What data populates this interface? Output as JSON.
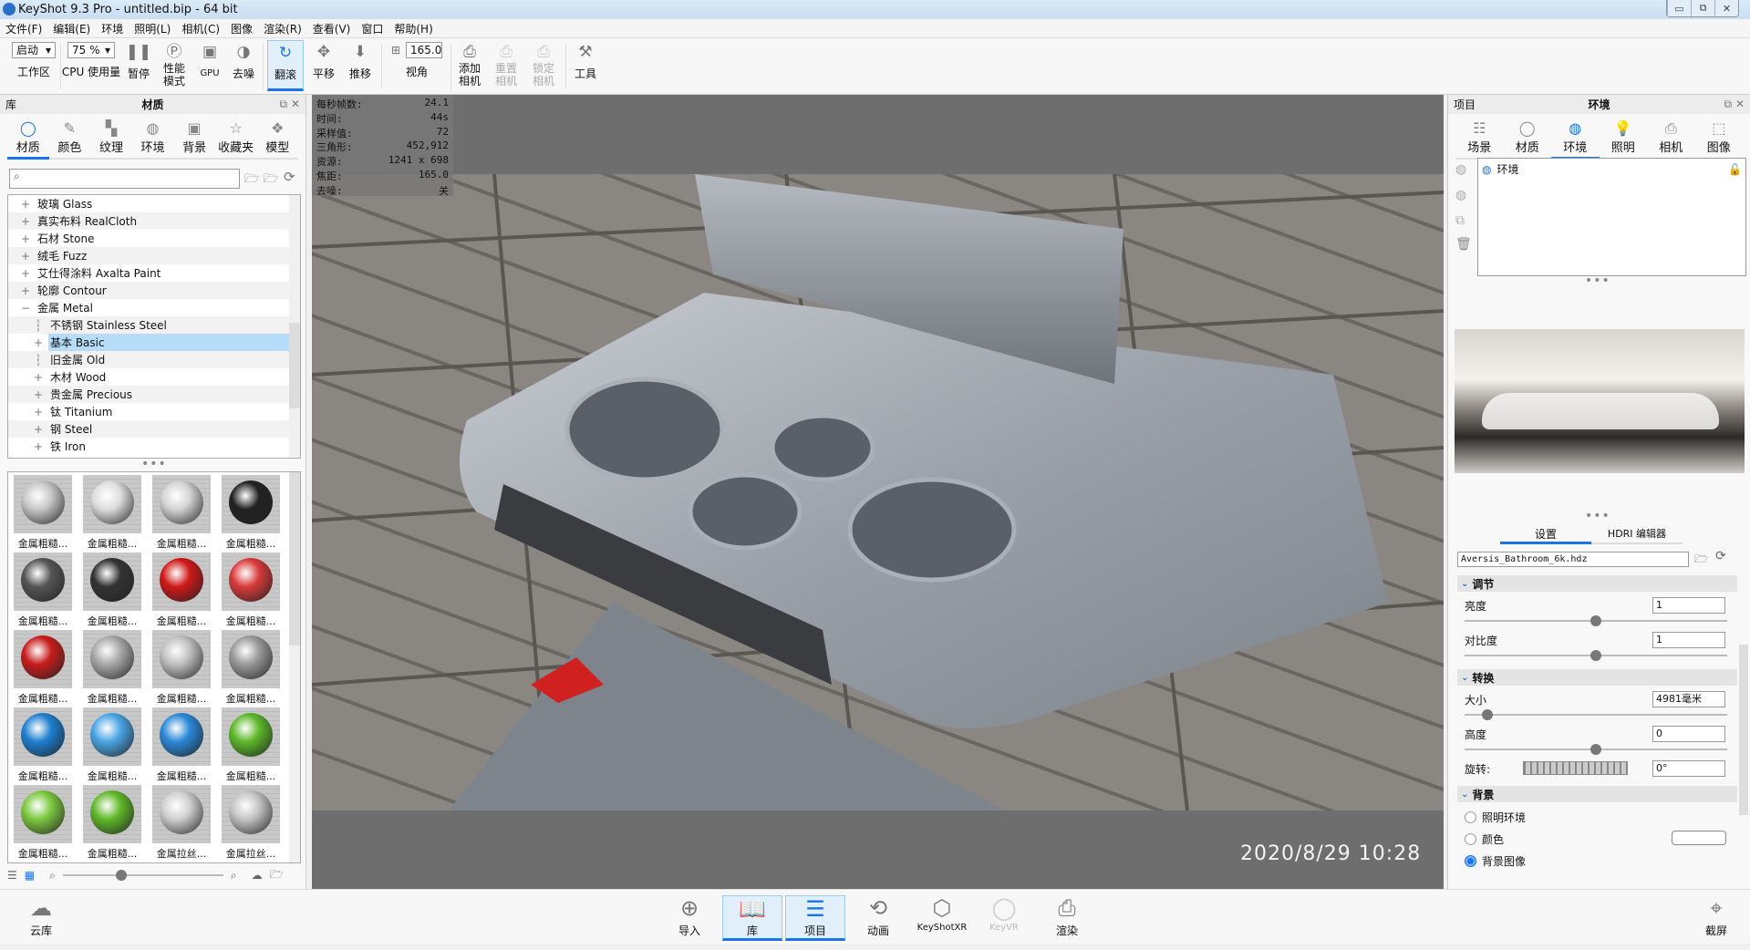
{
  "title": "KeyShot 9.3 Pro  - untitled.bip  - 64 bit",
  "window_buttons": [
    "minimize",
    "restore",
    "close"
  ],
  "menu": [
    "文件(F)",
    "编辑(E)",
    "环境",
    "照明(L)",
    "相机(C)",
    "图像",
    "渲染(R)",
    "查看(V)",
    "窗口",
    "帮助(H)"
  ],
  "toolbar": {
    "workspace_value": "启动",
    "workspace_label": "工作区",
    "cpu_value": "75 %",
    "cpu_label": "CPU 使用量",
    "pause": "暂停",
    "performance": "性能\n模式",
    "gpu": "GPU",
    "denoise": "去噪",
    "tumble": "翻滚",
    "pan": "平移",
    "dolly": "推移",
    "fov_value": "165.0",
    "fov_label": "视角",
    "add_camera": "添加\n相机",
    "reset_camera": "重置\n相机",
    "lock_camera": "锁定\n相机",
    "tools": "工具"
  },
  "library": {
    "header_left": "库",
    "header_title": "材质",
    "tabs": [
      {
        "label": "材质",
        "icon": "material-icon"
      },
      {
        "label": "颜色",
        "icon": "color-icon"
      },
      {
        "label": "纹理",
        "icon": "texture-icon"
      },
      {
        "label": "环境",
        "icon": "globe-icon"
      },
      {
        "label": "背景",
        "icon": "image-icon"
      },
      {
        "label": "收藏夹",
        "icon": "star-icon"
      },
      {
        "label": "模型",
        "icon": "model-icon"
      }
    ],
    "active_tab": "材质",
    "search_placeholder": "",
    "tree": [
      {
        "label": "玻璃 Glass",
        "level": 0,
        "expander": "+"
      },
      {
        "label": "真实布料 RealCloth",
        "level": 0,
        "expander": "+"
      },
      {
        "label": "石材 Stone",
        "level": 0,
        "expander": "+"
      },
      {
        "label": "绒毛 Fuzz",
        "level": 0,
        "expander": "+"
      },
      {
        "label": "艾仕得涂料 Axalta Paint",
        "level": 0,
        "expander": "+"
      },
      {
        "label": "轮廓 Contour",
        "level": 0,
        "expander": "+"
      },
      {
        "label": "金属 Metal",
        "level": 0,
        "expander": "−"
      },
      {
        "label": "不锈钢 Stainless Steel",
        "level": 1,
        "expander": ""
      },
      {
        "label": "基本 Basic",
        "level": 1,
        "expander": "+",
        "selected": true
      },
      {
        "label": "旧金属 Old",
        "level": 1,
        "expander": ""
      },
      {
        "label": "木材 Wood",
        "level": 1,
        "expander": "+"
      },
      {
        "label": "贵金属 Precious",
        "level": 1,
        "expander": "+"
      },
      {
        "label": "钛 Titanium",
        "level": 1,
        "expander": "+"
      },
      {
        "label": "钢 Steel",
        "level": 1,
        "expander": "+"
      },
      {
        "label": "铁 Iron",
        "level": 1,
        "expander": "+"
      }
    ],
    "materials": [
      {
        "label": "金属粗糙...",
        "color": "#c8c8c8"
      },
      {
        "label": "金属粗糙...",
        "color": "#dedede"
      },
      {
        "label": "金属粗糙...",
        "color": "#d4d4d4"
      },
      {
        "label": "金属粗糙...",
        "color": "#222222"
      },
      {
        "label": "金属粗糙...",
        "color": "#555555"
      },
      {
        "label": "金属粗糙...",
        "color": "#333333"
      },
      {
        "label": "金属粗糙...",
        "color": "#d01818"
      },
      {
        "label": "金属粗糙...",
        "color": "#d83a3a"
      },
      {
        "label": "金属粗糙...",
        "color": "#c81c1c"
      },
      {
        "label": "金属粗糙...",
        "color": "#a8a8a8"
      },
      {
        "label": "金属粗糙...",
        "color": "#c0c0c0"
      },
      {
        "label": "金属粗糙...",
        "color": "#9a9a9a"
      },
      {
        "label": "金属粗糙...",
        "color": "#1e7fd0"
      },
      {
        "label": "金属粗糙...",
        "color": "#4aa5e5"
      },
      {
        "label": "金属粗糙...",
        "color": "#2a88d8"
      },
      {
        "label": "金属粗糙...",
        "color": "#5cb82a"
      },
      {
        "label": "金属粗糙...",
        "color": "#7cc840"
      },
      {
        "label": "金属粗糙...",
        "color": "#60b828"
      },
      {
        "label": "金属拉丝...",
        "color": "#d0d0d0"
      },
      {
        "label": "金属拉丝...",
        "color": "#c4c4c4"
      }
    ]
  },
  "viewport": {
    "stats": [
      {
        "k": "每秒帧数:",
        "v": "24.1"
      },
      {
        "k": "时间:",
        "v": "44s"
      },
      {
        "k": "采样值:",
        "v": "72"
      },
      {
        "k": "三角形:",
        "v": "452,912"
      },
      {
        "k": "资源:",
        "v": "1241 x 698"
      },
      {
        "k": "焦距:",
        "v": "165.0"
      },
      {
        "k": "去噪:",
        "v": "关"
      }
    ],
    "timestamp": "2020/8/29  10:28"
  },
  "project": {
    "header_left": "项目",
    "header_title": "环境",
    "tabs": [
      {
        "label": "场景",
        "icon": "scene-icon"
      },
      {
        "label": "材质",
        "icon": "material-icon"
      },
      {
        "label": "环境",
        "icon": "globe-icon"
      },
      {
        "label": "照明",
        "icon": "bulb-icon"
      },
      {
        "label": "相机",
        "icon": "camera-icon"
      },
      {
        "label": "图像",
        "icon": "image-frame-icon"
      }
    ],
    "active_tab": "环境",
    "env_list": [
      "环境"
    ],
    "subtabs": [
      "设置",
      "HDRI 编辑器"
    ],
    "hdri_file": "Aversis_Bathroom_6k.hdz",
    "sections": {
      "adjust": "调节",
      "transform": "转换",
      "background": "背景"
    },
    "brightness": {
      "label": "亮度",
      "value": "1",
      "slider": 0.5
    },
    "contrast": {
      "label": "对比度",
      "value": "1",
      "slider": 0.5
    },
    "size": {
      "label": "大小",
      "value": "4981毫米",
      "slider": 0.07
    },
    "height": {
      "label": "高度",
      "value": "0",
      "slider": 0.5
    },
    "rotation": {
      "label": "旋转:",
      "value": "0°"
    },
    "bg_options": [
      {
        "label": "照明环境",
        "checked": false
      },
      {
        "label": "颜色",
        "checked": false
      },
      {
        "label": "背景图像",
        "checked": true
      }
    ],
    "bg_color": "#ffffff"
  },
  "bottombar": {
    "cloud": "云库",
    "import": "导入",
    "library": "库",
    "project": "项目",
    "animation": "动画",
    "keyshotxr": "KeyShotXR",
    "keyvr": "KeyVR",
    "render": "渲染",
    "screenshot": "截屏"
  },
  "colors": {
    "accent": "#1a73e8",
    "viewport_bg": "#6e6e6e",
    "selection": "#b5dcf9"
  }
}
